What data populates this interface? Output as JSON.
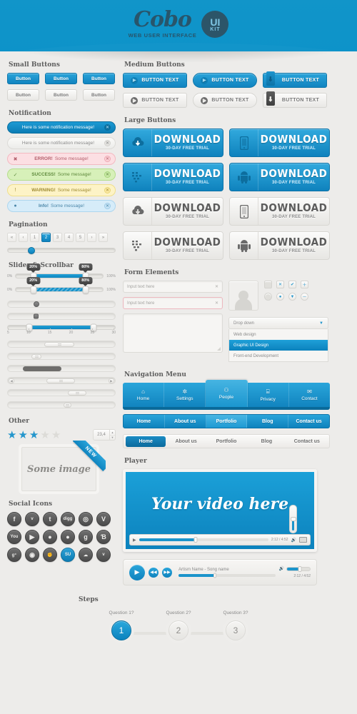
{
  "header": {
    "logo": "Cobo",
    "tagline": "WEB USER INTERFACE",
    "badge_top": "UI",
    "badge_bottom": "KIT"
  },
  "sections": {
    "small_buttons": "Small Buttons",
    "notification": "Notification",
    "pagination": "Pagination",
    "slider": "Slider & Scrollbar",
    "other": "Other",
    "social": "Social Icons",
    "medium_buttons": "Medium Buttons",
    "large_buttons": "Large Buttons",
    "form": "Form Elements",
    "nav": "Navigation Menu",
    "player": "Player",
    "steps": "Steps"
  },
  "small_buttons": [
    {
      "label": "Button",
      "style": "blue"
    },
    {
      "label": "Button",
      "style": "blue"
    },
    {
      "label": "Button",
      "style": "blue"
    },
    {
      "label": "Button",
      "style": "gray"
    },
    {
      "label": "Button",
      "style": "gray"
    },
    {
      "label": "Button",
      "style": "gray"
    }
  ],
  "medium_buttons": [
    {
      "label": "BUTTON TEXT",
      "style": "blue",
      "shape": "square",
      "icon": "play-circle-icon"
    },
    {
      "label": "BUTTON TEXT",
      "style": "blue",
      "shape": "round",
      "icon": "play-circle-icon"
    },
    {
      "label": "BUTTON TEXT",
      "style": "blue",
      "shape": "tab",
      "icon": "download-tab-icon"
    },
    {
      "label": "BUTTON TEXT",
      "style": "gray",
      "shape": "square",
      "icon": "play-circle-icon"
    },
    {
      "label": "BUTTON TEXT",
      "style": "gray",
      "shape": "round",
      "icon": "play-circle-icon"
    },
    {
      "label": "BUTTON TEXT",
      "style": "gray",
      "shape": "tab",
      "icon": "download-tab-icon"
    }
  ],
  "large_buttons": [
    {
      "title": "DOWNLOAD",
      "sub": "30-DAY FREE TRIAL",
      "style": "blue",
      "icon": "cloud-download-icon"
    },
    {
      "title": "DOWNLOAD",
      "sub": "30-DAY FREE TRIAL",
      "style": "blue",
      "icon": "mobile-phone-icon"
    },
    {
      "title": "DOWNLOAD",
      "sub": "30-DAY FREE TRIAL",
      "style": "blue",
      "icon": "blackberry-icon"
    },
    {
      "title": "DOWNLOAD",
      "sub": "30-DAY FREE TRIAL",
      "style": "blue",
      "icon": "android-icon"
    },
    {
      "title": "DOWNLOAD",
      "sub": "30-DAY FREE TRIAL",
      "style": "gray",
      "icon": "cloud-download-icon"
    },
    {
      "title": "DOWNLOAD",
      "sub": "30-DAY FREE TRIAL",
      "style": "gray",
      "icon": "mobile-phone-icon"
    },
    {
      "title": "DOWNLOAD",
      "sub": "30-DAY FREE TRIAL",
      "style": "gray",
      "icon": "blackberry-icon"
    },
    {
      "title": "DOWNLOAD",
      "sub": "30-DAY FREE TRIAL",
      "style": "gray",
      "icon": "android-icon"
    }
  ],
  "notifications": [
    {
      "prefix": "",
      "text": "Here is some notification message!",
      "style": "n-blue",
      "icon": "",
      "close": "✕"
    },
    {
      "prefix": "",
      "text": "Here is some notification message!",
      "style": "n-gray",
      "icon": "",
      "close": "✕"
    },
    {
      "prefix": "ERROR!",
      "text": "Some  message!",
      "style": "n-error",
      "icon": "✖",
      "close": "✕"
    },
    {
      "prefix": "SUCCESS!",
      "text": "Some  message!",
      "style": "n-success",
      "icon": "✓",
      "close": "✕"
    },
    {
      "prefix": "WARNING!",
      "text": "Some  message!",
      "style": "n-warning",
      "icon": "!",
      "close": "✕"
    },
    {
      "prefix": "Info!",
      "text": "Some  message!",
      "style": "n-info",
      "icon": "●",
      "close": "✕"
    }
  ],
  "pagination": {
    "items": [
      "«",
      "‹",
      "1",
      "2",
      "3",
      "4",
      "5",
      "›",
      "»"
    ],
    "active": "2"
  },
  "sliders": {
    "min_label": "0%",
    "max_label": "100%",
    "tip_low": "20%",
    "tip_high": "80%",
    "range_ticks": [
      "5",
      "10",
      "15",
      "20",
      "25",
      "30"
    ]
  },
  "other": {
    "stars_filled": 3,
    "stars_total": 5,
    "spinner_value": "23,4",
    "image_caption": "Some image",
    "ribbon_label": "NEW"
  },
  "social_icons": [
    {
      "name": "facebook-icon",
      "glyph": "f",
      "style": "dark"
    },
    {
      "name": "twitter-bird-icon",
      "glyph": "ᵛ",
      "style": "dark"
    },
    {
      "name": "tumblr-icon",
      "glyph": "t",
      "style": "dark"
    },
    {
      "name": "digg-icon",
      "glyph": "digg",
      "style": "dark"
    },
    {
      "name": "chrome-icon",
      "glyph": "◎",
      "style": "dark"
    },
    {
      "name": "vimeo-icon",
      "glyph": "V",
      "style": "dark"
    },
    {
      "name": "youtube-icon",
      "glyph": "You",
      "style": "dark"
    },
    {
      "name": "play-icon",
      "glyph": "▶",
      "style": "dark"
    },
    {
      "name": "dribbble-icon",
      "glyph": "●",
      "style": "dark"
    },
    {
      "name": "comment-icon",
      "glyph": "●",
      "style": "dark"
    },
    {
      "name": "google-plus-icon",
      "glyph": "g",
      "style": "dark"
    },
    {
      "name": "behance-icon",
      "glyph": "Ɓ",
      "style": "dark"
    },
    {
      "name": "google-plus-alt-icon",
      "glyph": "g⁺",
      "style": "dark"
    },
    {
      "name": "reddit-icon",
      "glyph": "◉",
      "style": "dark"
    },
    {
      "name": "hand-icon",
      "glyph": "✊",
      "style": "dark"
    },
    {
      "name": "stumbleupon-icon",
      "glyph": "SU",
      "style": "blue"
    },
    {
      "name": "cloud-icon",
      "glyph": "☁",
      "style": "dark"
    },
    {
      "name": "twitter-icon",
      "glyph": "ᵛ",
      "style": "dark"
    }
  ],
  "form": {
    "input_value": "Input text here",
    "input_error_value": "Input text here",
    "clear_icon": "✕",
    "dropdown_label": "Drop down",
    "dropdown_options": [
      "Web design",
      "Graphic UI Design",
      "Front-end Development"
    ],
    "dropdown_selected": "Graphic UI Design",
    "checks": [
      "✕",
      "✔",
      "＋"
    ],
    "radios": [
      "●",
      "▼",
      "－"
    ]
  },
  "nav": {
    "icon_menu": [
      {
        "label": "Home",
        "icon": "home-icon",
        "glyph": "⌂",
        "active": false
      },
      {
        "label": "Settings",
        "icon": "gear-icon",
        "glyph": "⚙",
        "active": false
      },
      {
        "label": "People",
        "icon": "people-icon",
        "glyph": "👤",
        "active": true
      },
      {
        "label": "Privacy",
        "icon": "lock-icon",
        "glyph": "🔒",
        "active": false
      },
      {
        "label": "Contact",
        "icon": "mail-icon",
        "glyph": "✉",
        "active": false
      }
    ],
    "blue_menu": [
      {
        "label": "Home",
        "active": false
      },
      {
        "label": "About us",
        "active": false
      },
      {
        "label": "Portfolio",
        "active": true
      },
      {
        "label": "Blog",
        "active": false
      },
      {
        "label": "Contact us",
        "active": false
      }
    ],
    "light_menu": [
      {
        "label": "Home",
        "active": true
      },
      {
        "label": "About us",
        "active": false
      },
      {
        "label": "Portfolio",
        "active": false
      },
      {
        "label": "Blog",
        "active": false
      },
      {
        "label": "Contact us",
        "active": false
      }
    ]
  },
  "player": {
    "video_title": "Your video here",
    "video_time": "2:12 / 4:52",
    "play_icon": "▶",
    "volume_icon": "🔊",
    "audio_title": "Artism Name - Song name",
    "audio_time": "2:12 / 4:52",
    "rewind_icon": "◀◀",
    "forward_icon": "▶▶"
  },
  "steps": [
    {
      "label": "Question 1?",
      "number": "1",
      "active": true
    },
    {
      "label": "Question 2?",
      "number": "2",
      "active": false
    },
    {
      "label": "Question 3?",
      "number": "3",
      "active": false
    }
  ],
  "colors": {
    "accent": "#1a9ed4",
    "accent_dark": "#0d7fb5",
    "header": "#1195c9",
    "logo": "#28556b"
  }
}
